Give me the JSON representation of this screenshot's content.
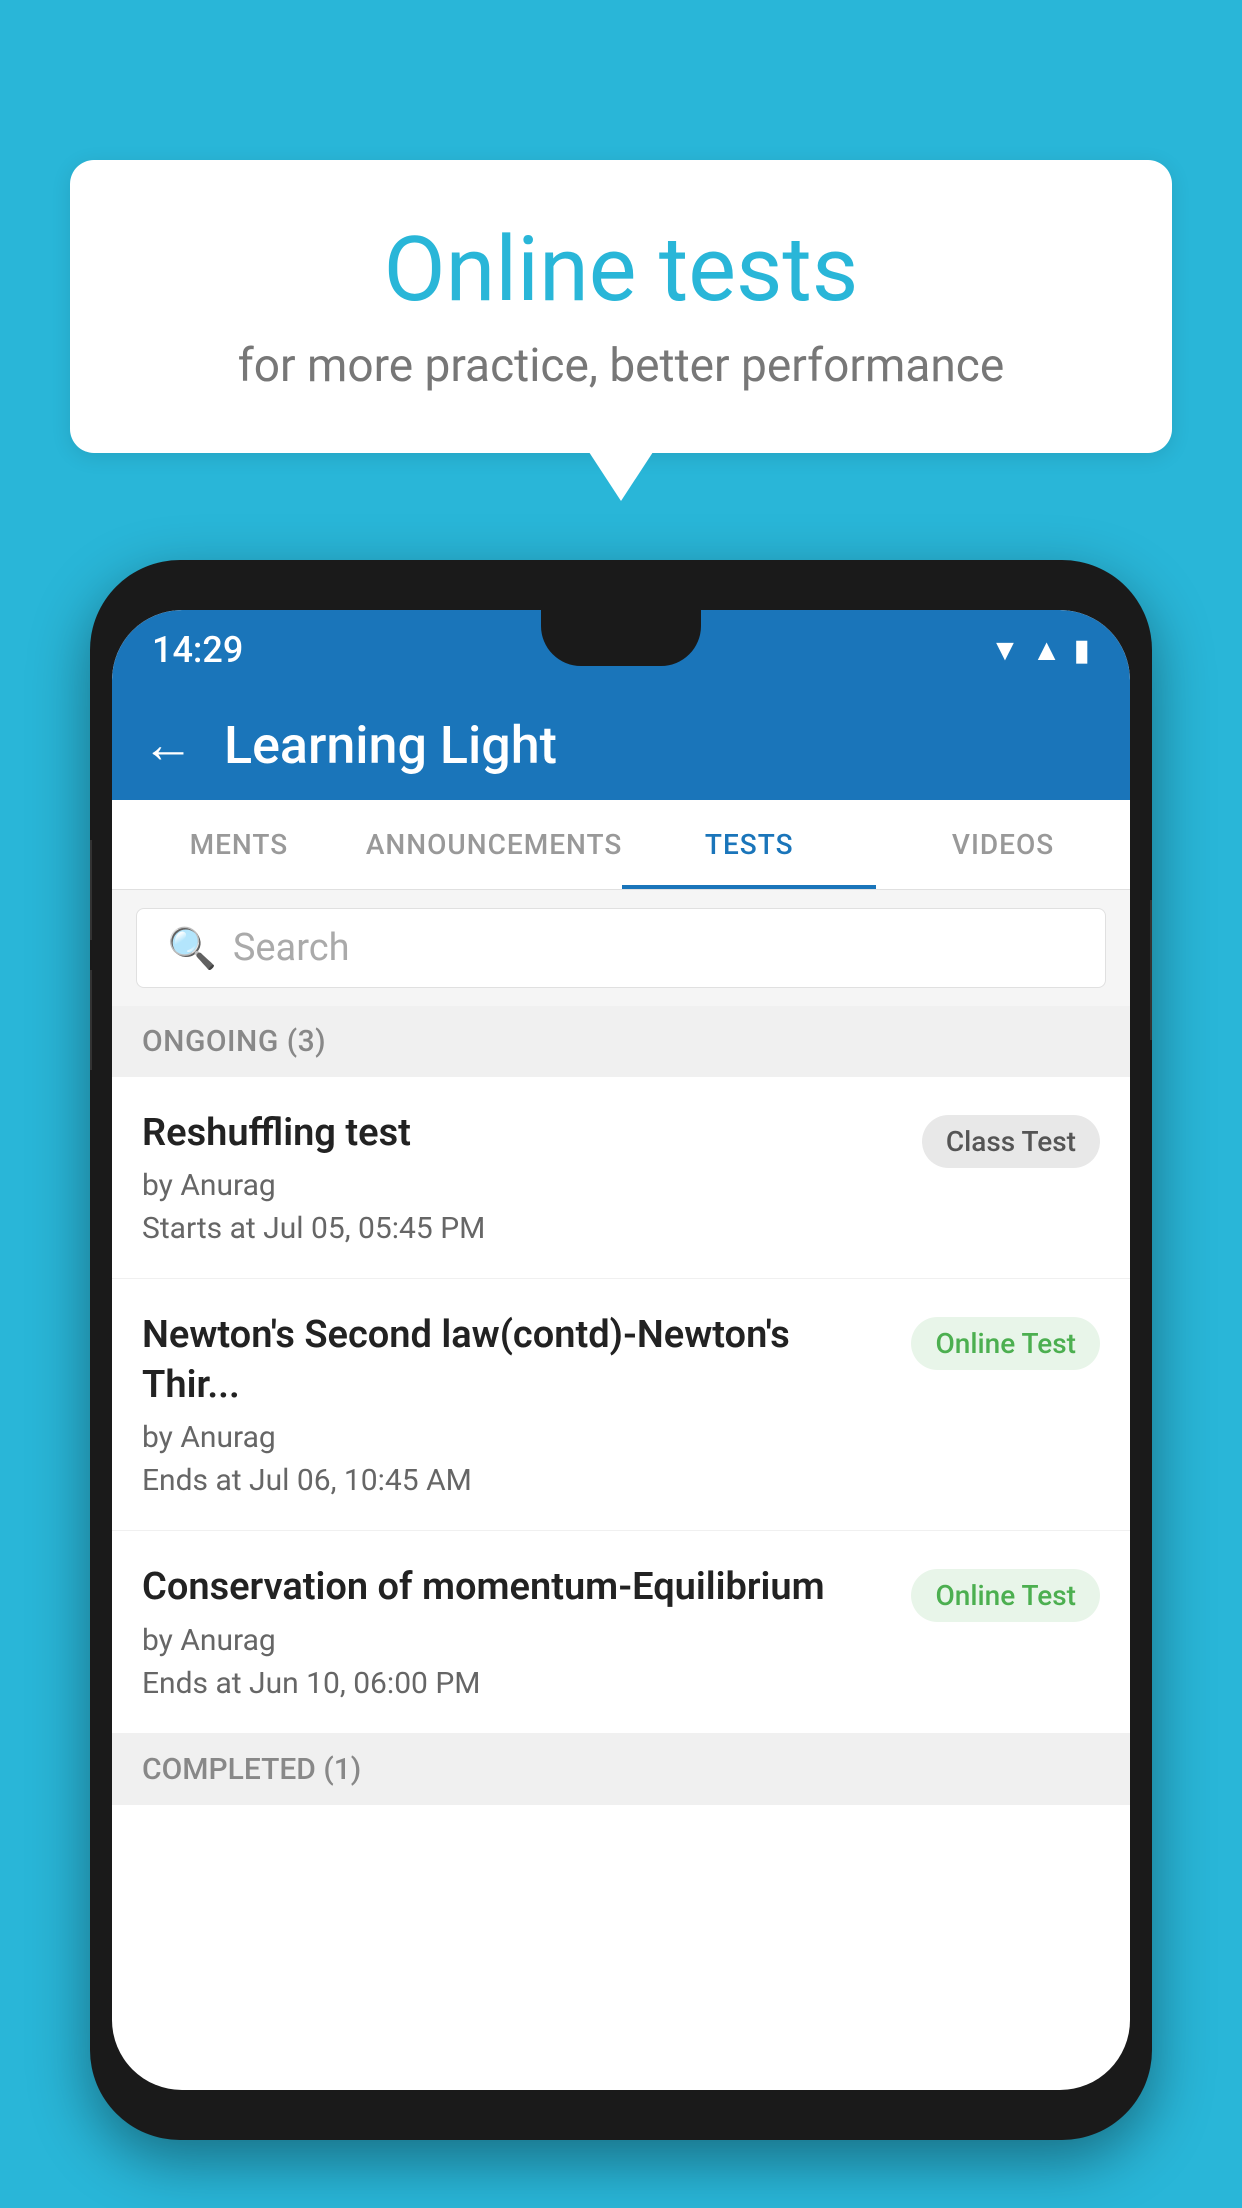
{
  "background": {
    "color": "#29b6d8"
  },
  "speech_bubble": {
    "title": "Online tests",
    "subtitle": "for more practice, better performance"
  },
  "phone": {
    "status_bar": {
      "time": "14:29",
      "icons": [
        "wifi",
        "signal",
        "battery"
      ]
    },
    "app_bar": {
      "title": "Learning Light",
      "back_label": "←"
    },
    "tabs": [
      {
        "label": "MENTS",
        "active": false
      },
      {
        "label": "ANNOUNCEMENTS",
        "active": false
      },
      {
        "label": "TESTS",
        "active": true
      },
      {
        "label": "VIDEOS",
        "active": false
      }
    ],
    "search": {
      "placeholder": "Search"
    },
    "ongoing_section": {
      "header": "ONGOING (3)",
      "tests": [
        {
          "name": "Reshuffling test",
          "author": "by Anurag",
          "date": "Starts at  Jul 05, 05:45 PM",
          "badge": "Class Test",
          "badge_type": "class"
        },
        {
          "name": "Newton's Second law(contd)-Newton's Thir...",
          "author": "by Anurag",
          "date": "Ends at  Jul 06, 10:45 AM",
          "badge": "Online Test",
          "badge_type": "online"
        },
        {
          "name": "Conservation of momentum-Equilibrium",
          "author": "by Anurag",
          "date": "Ends at  Jun 10, 06:00 PM",
          "badge": "Online Test",
          "badge_type": "online"
        }
      ]
    },
    "completed_section": {
      "header": "COMPLETED (1)"
    }
  }
}
